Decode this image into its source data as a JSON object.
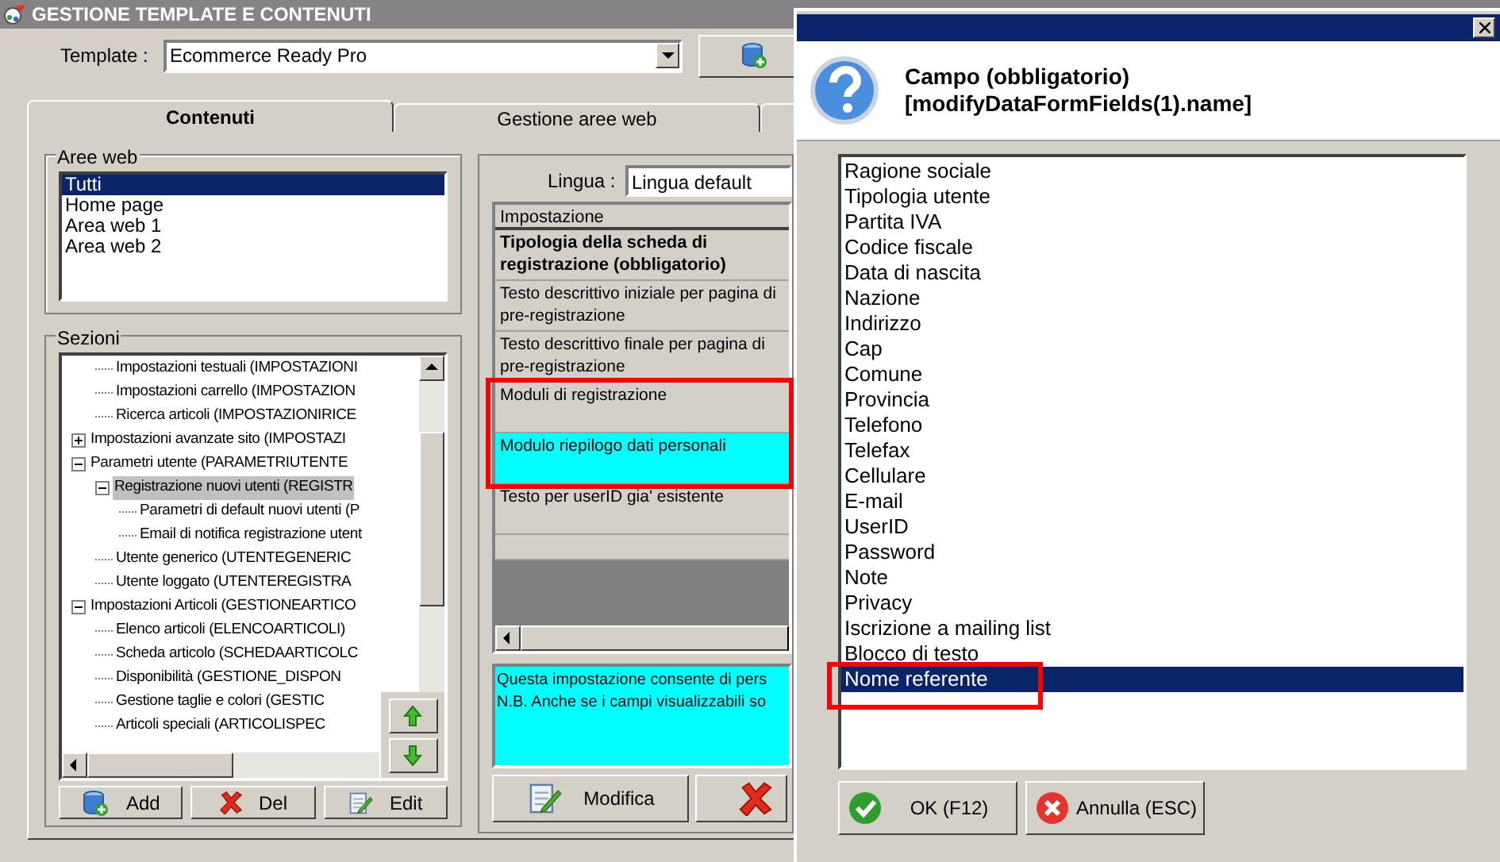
{
  "window": {
    "title": "GESTIONE TEMPLATE E CONTENUTI"
  },
  "template": {
    "label": "Template :",
    "value": "Ecommerce Ready Pro"
  },
  "tabs": [
    {
      "label": "Contenuti",
      "selected": true
    },
    {
      "label": "Gestione aree web",
      "selected": false
    }
  ],
  "aree_web": {
    "title": "Aree web",
    "items": [
      {
        "label": "Tutti",
        "selected": true
      },
      {
        "label": "Home page",
        "selected": false
      },
      {
        "label": "Area web 1",
        "selected": false
      },
      {
        "label": "Area web 2",
        "selected": false
      }
    ]
  },
  "sezioni": {
    "title": "Sezioni",
    "tree": [
      {
        "children": [
          {
            "label": "Impostazioni testuali (IMPOSTAZIONI",
            "selected": false
          },
          {
            "label": "Impostazioni carrello (IMPOSTAZION",
            "selected": false
          },
          {
            "label": "Ricerca articoli (IMPOSTAZIONIRICE",
            "selected": false
          }
        ]
      },
      {
        "label": "Impostazioni avanzate sito (IMPOSTAZI",
        "selected": false,
        "expanded": false
      },
      {
        "label": "Parametri utente (PARAMETRIUTENTE",
        "selected": false,
        "expanded": true,
        "children": [
          {
            "label": "Registrazione nuovi utenti (REGISTR",
            "selected": true,
            "expanded": true,
            "children": [
              {
                "label": "Parametri di default nuovi utenti (P",
                "selected": false
              },
              {
                "label": "Email di notifica registrazione utent",
                "selected": false
              }
            ]
          },
          {
            "label": "Utente generico (UTENTEGENERIC",
            "selected": false
          },
          {
            "label": "Utente loggato (UTENTEREGISTRA",
            "selected": false
          }
        ]
      },
      {
        "label": "Impostazioni Articoli (GESTIONEARTICO",
        "selected": false,
        "expanded": true,
        "children": [
          {
            "label": "Elenco articoli (ELENCOARTICOLI)",
            "selected": false
          },
          {
            "label": "Scheda articolo (SCHEDAARTICOLC",
            "selected": false
          },
          {
            "label": "Disponibilità (GESTIONE_DISPON",
            "selected": false
          },
          {
            "label": "Gestione taglie e colori (GESTIC",
            "selected": false
          },
          {
            "label": "Articoli speciali (ARTICOLISPEC",
            "selected": false
          }
        ]
      }
    ],
    "buttons": [
      {
        "label": "Add",
        "kind": "add"
      },
      {
        "label": "Del",
        "kind": "delete"
      },
      {
        "label": "Edit",
        "kind": "edit"
      }
    ]
  },
  "lingua": {
    "label": "Lingua :",
    "value": "Lingua default"
  },
  "grid": {
    "header": "Impostazione",
    "rows": [
      {
        "text": "Tipologia della scheda di registrazione (obbligatorio)",
        "bold": true,
        "selected": false,
        "framed": false
      },
      {
        "text": "Testo descrittivo iniziale per pagina di pre-registrazione",
        "bold": false,
        "selected": false,
        "framed": false
      },
      {
        "text": "Testo descrittivo finale per pagina di pre-registrazione",
        "bold": false,
        "selected": false,
        "framed": false
      },
      {
        "text": "Moduli di registrazione",
        "bold": false,
        "selected": false,
        "framed": true
      },
      {
        "text": "Modulo riepilogo dati personali",
        "bold": false,
        "selected": true,
        "framed": true
      },
      {
        "text": "Testo per userID gia' esistente",
        "bold": false,
        "selected": false,
        "framed": false
      }
    ]
  },
  "description": [
    "Questa impostazione consente di pers",
    "N.B. Anche se i campi visualizzabili so"
  ],
  "actions": {
    "modify": "Modifica"
  },
  "dialog": {
    "heading": [
      "Campo (obbligatorio)",
      "[modifyDataFormFields(1).name]"
    ],
    "items": [
      {
        "label": "Ragione sociale",
        "selected": false,
        "framed": false
      },
      {
        "label": "Tipologia utente",
        "selected": false,
        "framed": false
      },
      {
        "label": "Partita IVA",
        "selected": false,
        "framed": false
      },
      {
        "label": "Codice fiscale",
        "selected": false,
        "framed": false
      },
      {
        "label": "Data di nascita",
        "selected": false,
        "framed": false
      },
      {
        "label": "Nazione",
        "selected": false,
        "framed": false
      },
      {
        "label": "Indirizzo",
        "selected": false,
        "framed": false
      },
      {
        "label": "Cap",
        "selected": false,
        "framed": false
      },
      {
        "label": "Comune",
        "selected": false,
        "framed": false
      },
      {
        "label": "Provincia",
        "selected": false,
        "framed": false
      },
      {
        "label": "Telefono",
        "selected": false,
        "framed": false
      },
      {
        "label": "Telefax",
        "selected": false,
        "framed": false
      },
      {
        "label": "Cellulare",
        "selected": false,
        "framed": false
      },
      {
        "label": "E-mail",
        "selected": false,
        "framed": false
      },
      {
        "label": "UserID",
        "selected": false,
        "framed": false
      },
      {
        "label": "Password",
        "selected": false,
        "framed": false
      },
      {
        "label": "Note",
        "selected": false,
        "framed": false
      },
      {
        "label": "Privacy",
        "selected": false,
        "framed": false
      },
      {
        "label": "Iscrizione a mailing list",
        "selected": false,
        "framed": false
      },
      {
        "label": "Blocco di testo",
        "selected": false,
        "framed": false
      },
      {
        "label": "Nome referente",
        "selected": true,
        "framed": true
      }
    ],
    "buttons": [
      {
        "label": "OK (F12)",
        "kind": "ok"
      },
      {
        "label": "Annulla (ESC)",
        "kind": "cancel"
      }
    ]
  }
}
